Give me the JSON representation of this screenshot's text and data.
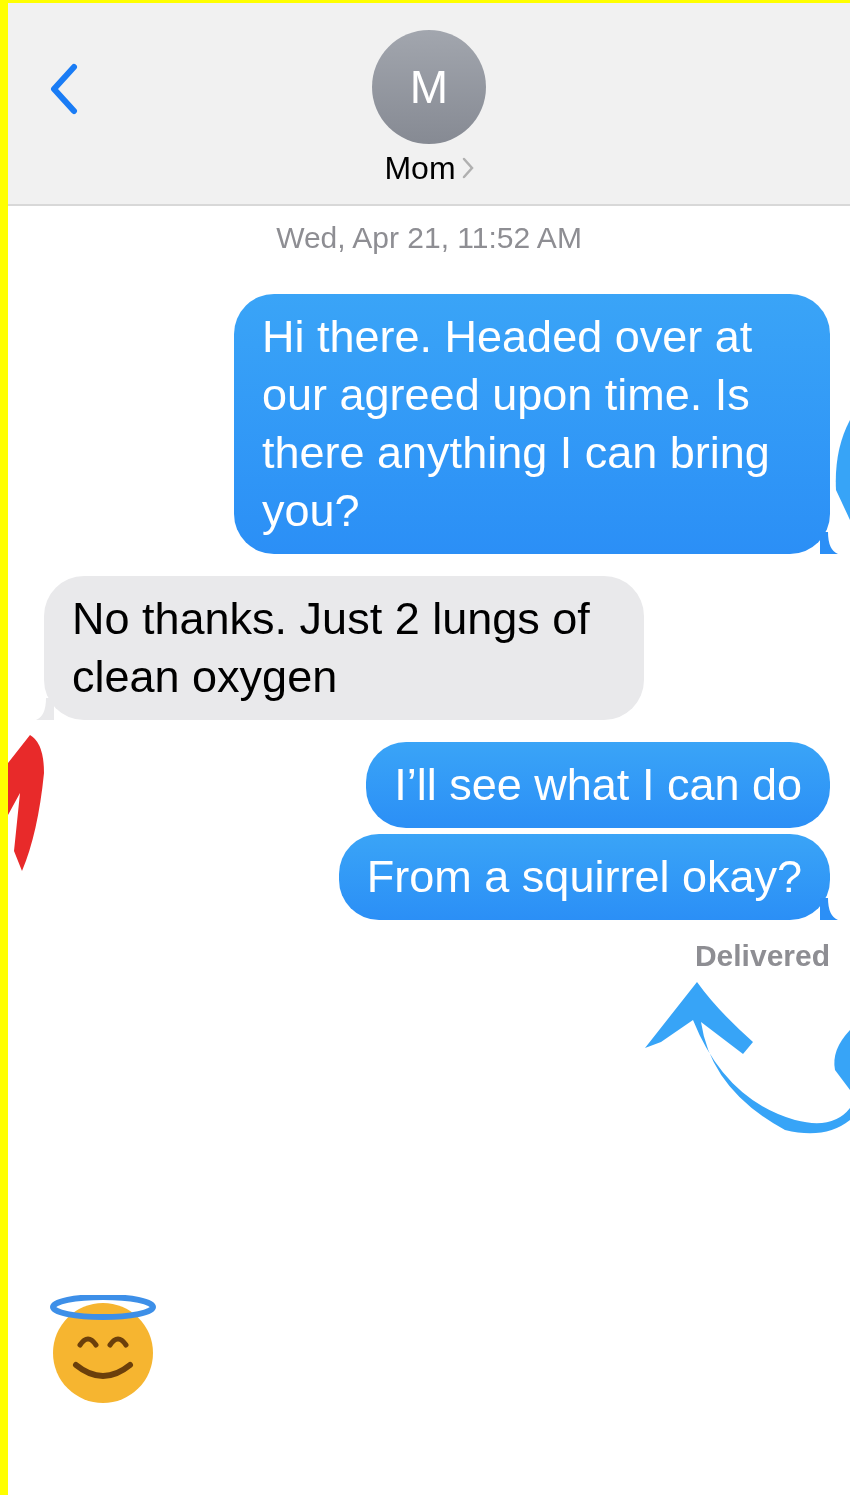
{
  "header": {
    "contact_initial": "M",
    "contact_name": "Mom"
  },
  "timestamp": "Wed, Apr 21, 11:52 AM",
  "messages": [
    {
      "kind": "sent",
      "text": "Hi there. Headed over at our agreed upon time. Is there anything I can bring you?",
      "tail": true
    },
    {
      "kind": "received",
      "text": "No thanks. Just 2 lungs of clean oxygen",
      "tail": true
    },
    {
      "kind": "sent",
      "text": "I’ll see what I can do",
      "tail": false
    },
    {
      "kind": "sent",
      "text": "From a squirrel okay?",
      "tail": true
    }
  ],
  "status": "Delivered"
}
